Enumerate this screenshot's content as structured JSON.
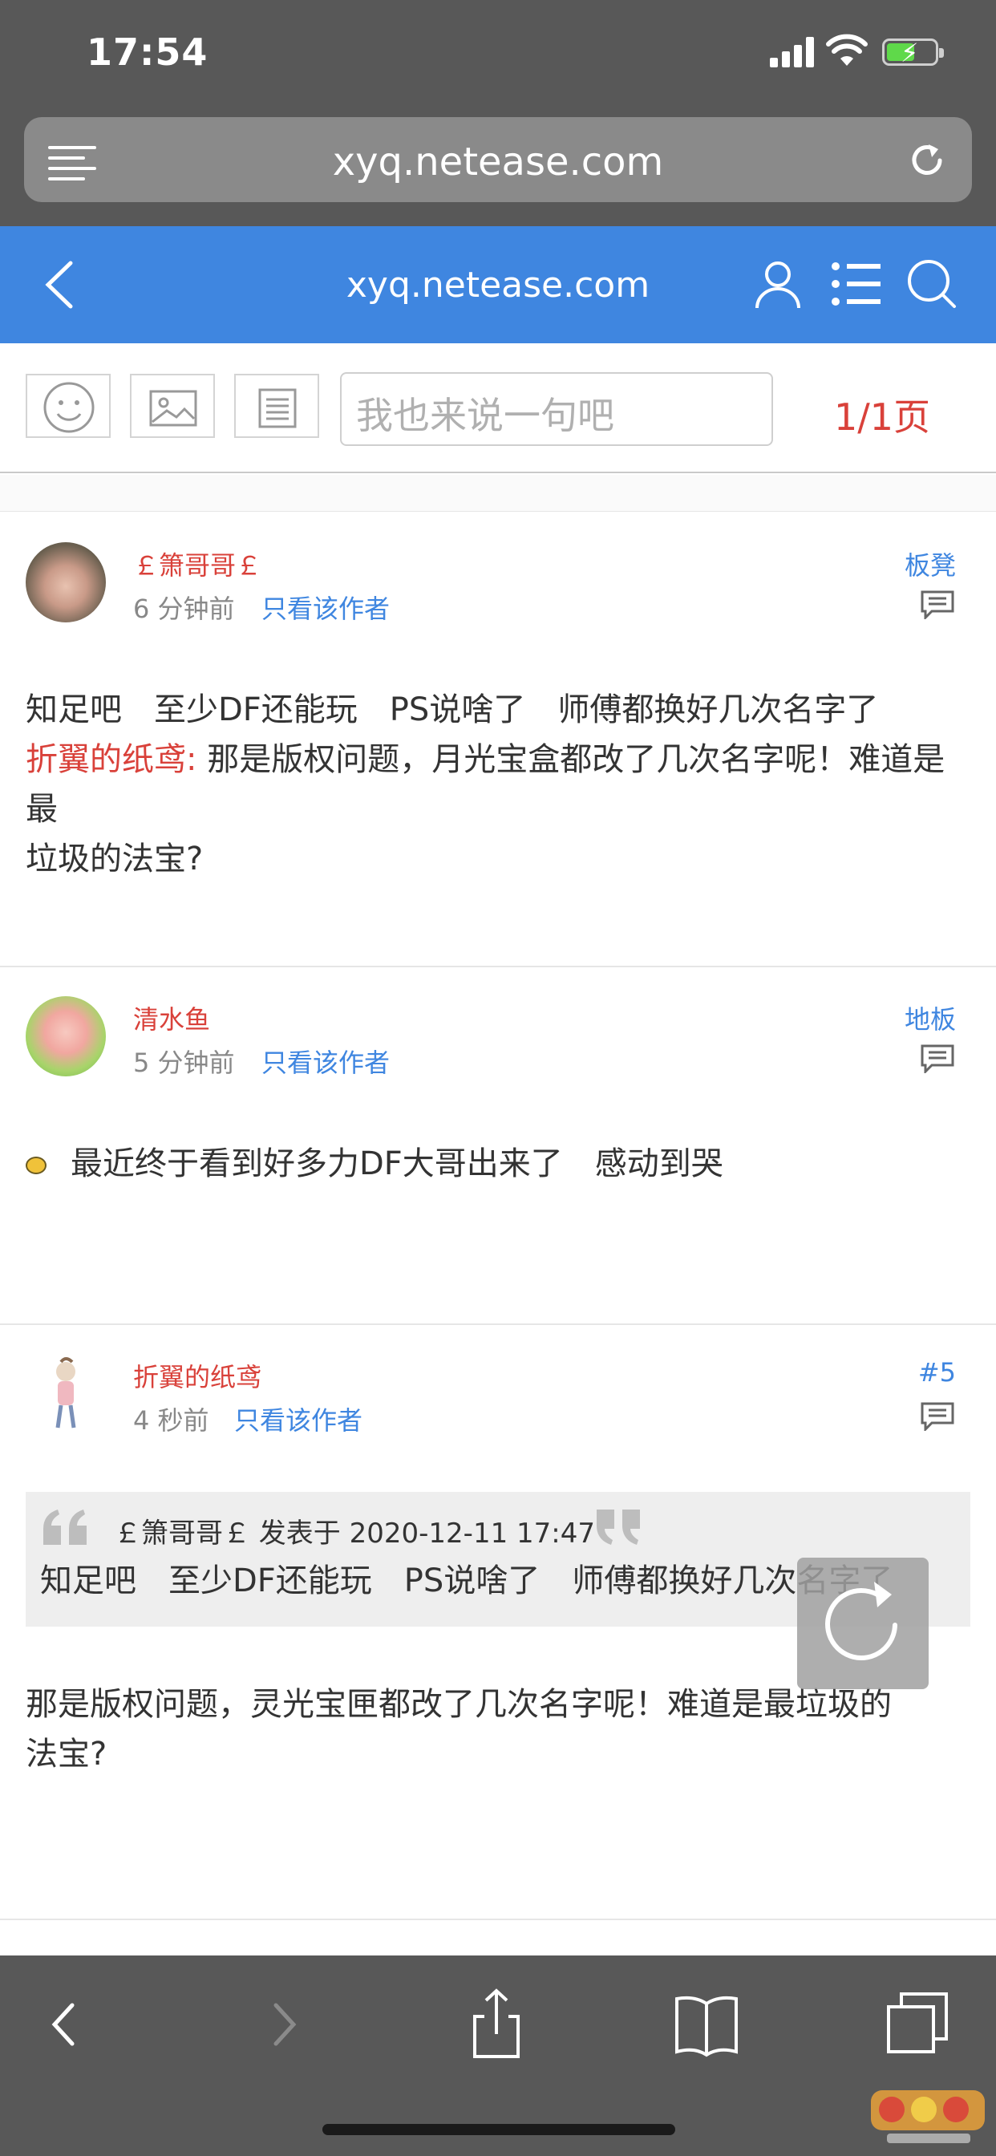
{
  "status": {
    "time": "17:54"
  },
  "browser": {
    "url": "xyq.netease.com"
  },
  "site": {
    "title": "xyq.netease.com"
  },
  "toolbar": {
    "placeholder": "我也来说一句吧",
    "page_indicator": "1/1页"
  },
  "posts": [
    {
      "author": "￡箫哥哥￡",
      "time": "6 分钟前",
      "only_author": "只看该作者",
      "floor": "板凳",
      "line1": "知足吧　至少DF还能玩　PS说啥了　师傅都换好几次名字了",
      "quote_name": "折翼的纸鸢:",
      "line2": " 那是版权问题，月光宝盒都改了几次名字呢！难道是最",
      "line3": "垃圾的法宝?"
    },
    {
      "author": "清水鱼",
      "time": "5 分钟前",
      "only_author": "只看该作者",
      "floor": "地板",
      "line1": "最近终于看到好多力DF大哥出来了　感动到哭"
    },
    {
      "author": "折翼的纸鸢",
      "time": "4 秒前",
      "only_author": "只看该作者",
      "floor": "#5",
      "quote_head": "￡箫哥哥￡ 发表于 2020-12-11 17:47",
      "quote_body": "知足吧　至少DF还能玩　PS说啥了　师傅都换好几次名字了",
      "line1": "那是版权问题，灵光宝匣都改了几次名字呢！难道是最垃圾的",
      "line2": "法宝?"
    }
  ],
  "icons": {
    "status": [
      "signal-icon",
      "wifi-icon",
      "battery-icon"
    ],
    "header": [
      "back-icon",
      "user-icon",
      "list-icon",
      "search-icon"
    ],
    "toolbar": [
      "emoji-icon",
      "image-icon",
      "text-icon"
    ],
    "bottom": [
      "back-arrow-icon",
      "forward-arrow-icon",
      "share-icon",
      "bookmarks-icon",
      "tabs-icon"
    ]
  },
  "colors": {
    "accent_blue": "#3f86e0",
    "author_red": "#d9413a",
    "chrome_gray": "#585858"
  }
}
